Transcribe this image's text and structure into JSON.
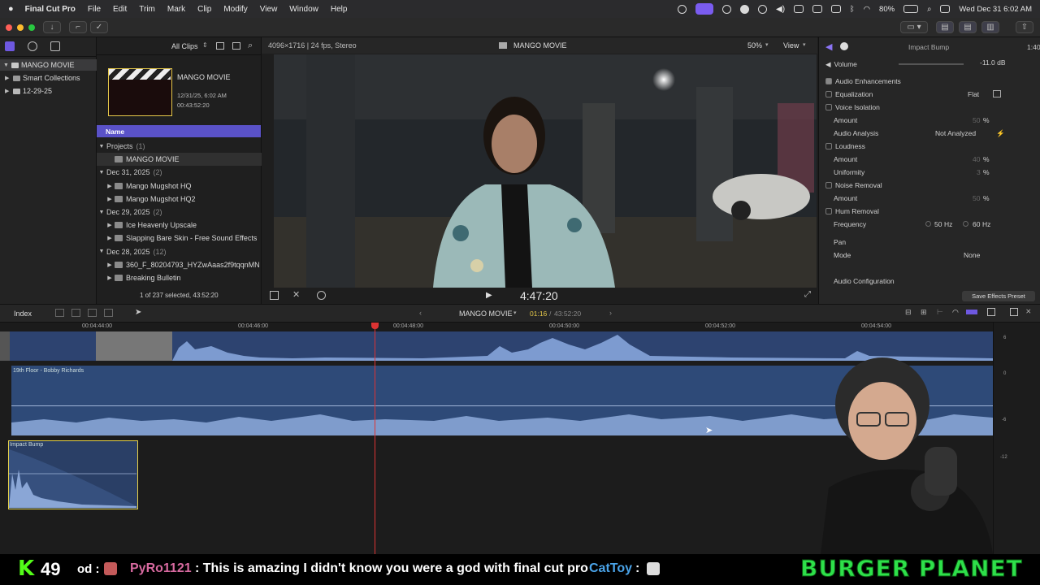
{
  "menubar": {
    "app_name": "Final Cut Pro",
    "items": [
      "File",
      "Edit",
      "Trim",
      "Mark",
      "Clip",
      "Modify",
      "View",
      "Window",
      "Help"
    ],
    "battery": "80%",
    "datetime": "Wed Dec 31  6:02 AM"
  },
  "browser": {
    "library": "MANGO MOVIE",
    "sidebar_items": [
      "Smart Collections",
      "12-29-25"
    ],
    "filter": "All Clips",
    "preview": {
      "title": "MANGO MOVIE",
      "date": "12/31/25, 6:02 AM",
      "duration": "00:43:52:20"
    },
    "column_header": "Name",
    "rows": [
      {
        "kind": "event",
        "label": "Projects",
        "count": "(1)"
      },
      {
        "kind": "project",
        "label": "MANGO MOVIE"
      },
      {
        "kind": "event",
        "label": "Dec 31, 2025",
        "count": "(2)"
      },
      {
        "kind": "clip",
        "label": "Mango Mugshot HQ"
      },
      {
        "kind": "clip",
        "label": "Mango Mugshot HQ2"
      },
      {
        "kind": "event",
        "label": "Dec 29, 2025",
        "count": "(2)"
      },
      {
        "kind": "clip",
        "label": "Ice Heavenly Upscale"
      },
      {
        "kind": "clip",
        "label": "Slapping Bare Skin - Free Sound Effects"
      },
      {
        "kind": "event",
        "label": "Dec 28, 2025",
        "count": "(12)"
      },
      {
        "kind": "clip",
        "label": "360_F_80204793_HYZwAaas2f9tqqnMN"
      },
      {
        "kind": "clip",
        "label": "Breaking Bulletin"
      }
    ],
    "status": "1 of 237 selected, 43:52:20"
  },
  "viewer": {
    "format": "4096×1716 | 24 fps, Stereo",
    "title": "MANGO MOVIE",
    "zoom": "50%",
    "view_label": "View",
    "timecode": "4:47:20"
  },
  "inspector": {
    "clip_name": "Impact Bump",
    "clip_duration": "1:40",
    "volume_label": "Volume",
    "volume_value": "-11.0  dB",
    "enhancements_label": "Audio Enhancements",
    "equalization": {
      "label": "Equalization",
      "value": "Flat"
    },
    "voice_isolation": {
      "label": "Voice Isolation",
      "amount_label": "Amount",
      "amount": "50",
      "unit": "%"
    },
    "audio_analysis": {
      "label": "Audio Analysis",
      "value": "Not Analyzed"
    },
    "loudness": {
      "label": "Loudness",
      "amount_label": "Amount",
      "amount": "40",
      "uniformity_label": "Uniformity",
      "uniformity": "3",
      "unit": "%"
    },
    "noise_removal": {
      "label": "Noise Removal",
      "amount_label": "Amount",
      "amount": "50",
      "unit": "%"
    },
    "hum_removal": {
      "label": "Hum Removal",
      "frequency_label": "Frequency",
      "opt1": "50",
      "opt2": "60",
      "unit": "Hz"
    },
    "pan_label": "Pan",
    "mode_label": "Mode",
    "mode_value": "None",
    "audio_config": "Audio Configuration",
    "save_preset": "Save Effects Preset"
  },
  "timeline": {
    "index_label": "Index",
    "project": "MANGO MOVIE",
    "position": "01:16",
    "total": "43:52:20",
    "ruler": [
      "00:04:44:00",
      "00:04:46:00",
      "00:04:48:00",
      "00:04:50:00",
      "00:04:52:00",
      "00:04:54:00"
    ],
    "clip1": "19th Floor - Bobby Richards",
    "clip2": "Impact Bump",
    "meter_scale": [
      "6",
      "0",
      "-6",
      "-12"
    ]
  },
  "stream": {
    "count": "49",
    "chat_prefix": "od :",
    "user": "PyRo1121",
    "message": ": This is amazing I didn't know you were a god with final cut pro",
    "user2": "CatToy",
    "user2_suffix": ":",
    "brand": "BURGER PLANET"
  },
  "colors": {
    "accent": "#7a5cf0",
    "selected_blue": "#5a52c8",
    "audio_clip": "#2e4a78",
    "playhead": "#dd3333",
    "brand_green": "#2ee04a"
  }
}
